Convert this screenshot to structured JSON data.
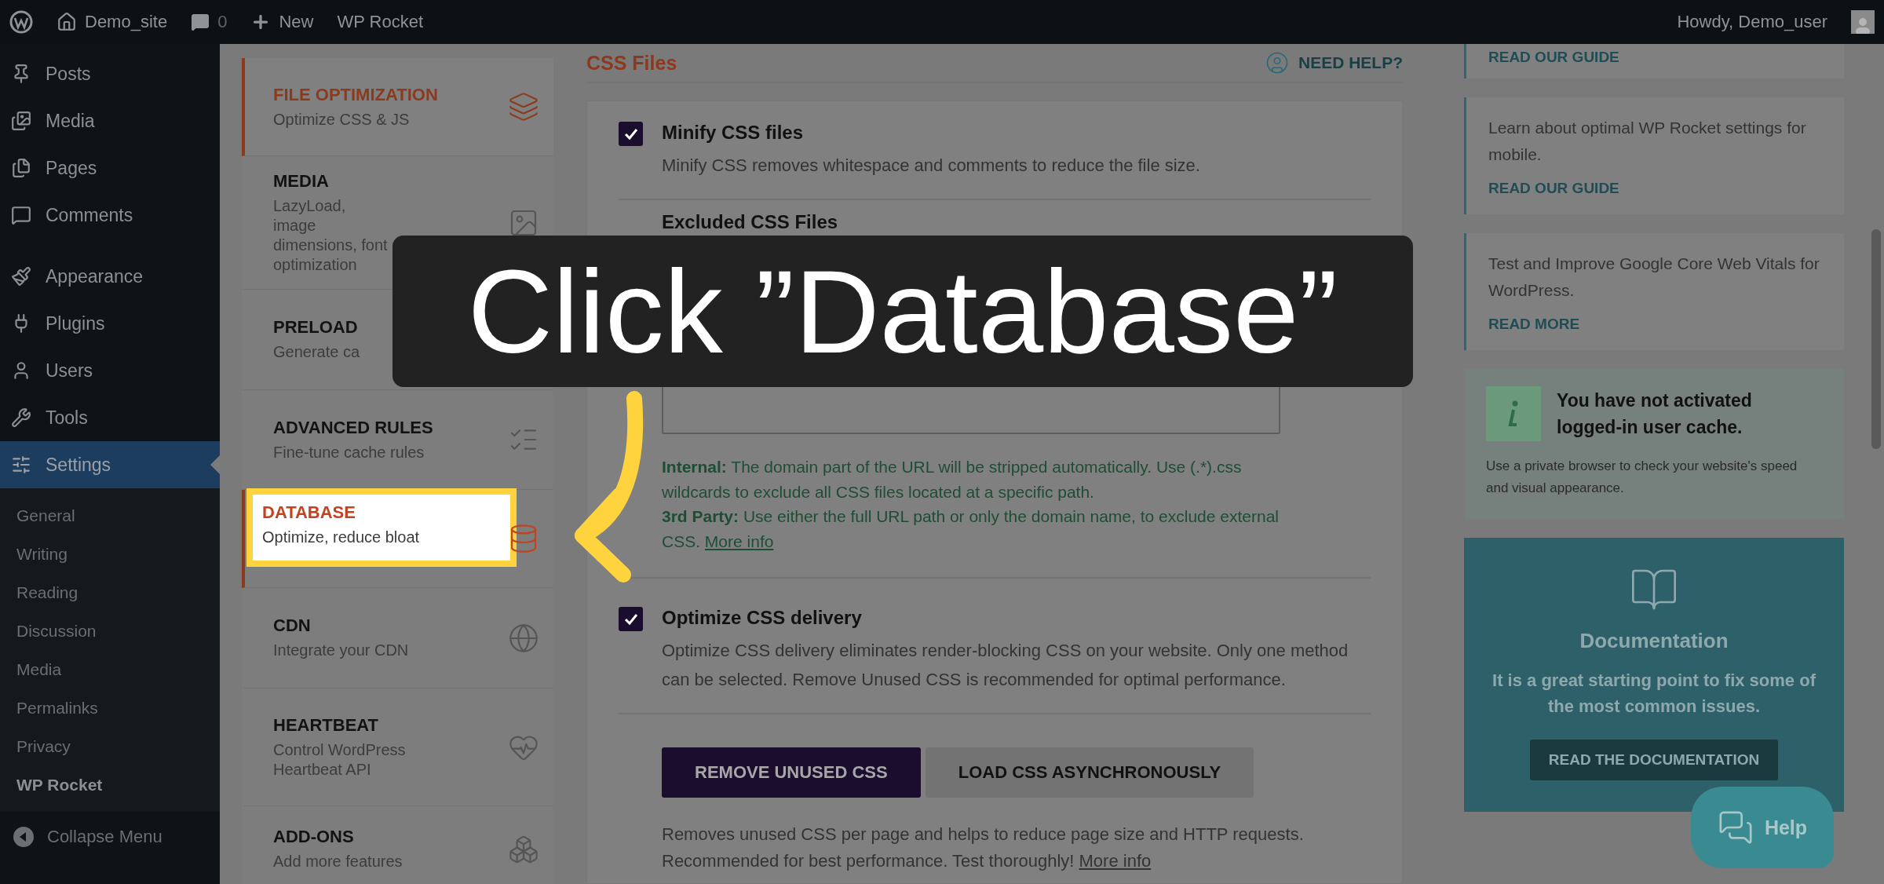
{
  "admin_bar": {
    "site": "Demo_site",
    "comments": "0",
    "new": "New",
    "plugin": "WP Rocket",
    "greeting": "Howdy, Demo_user"
  },
  "admin_menu": {
    "groups": [
      [
        {
          "label": "Posts",
          "selected": false
        },
        {
          "label": "Media",
          "selected": false
        },
        {
          "label": "Pages",
          "selected": false
        },
        {
          "label": "Comments",
          "selected": false
        }
      ],
      [
        {
          "label": "Appearance",
          "selected": false
        },
        {
          "label": "Plugins",
          "selected": false
        },
        {
          "label": "Users",
          "selected": false
        },
        {
          "label": "Tools",
          "selected": false
        },
        {
          "label": "Settings",
          "selected": true
        }
      ]
    ],
    "submenu": [
      {
        "label": "General",
        "selected": false
      },
      {
        "label": "Writing",
        "selected": false
      },
      {
        "label": "Reading",
        "selected": false
      },
      {
        "label": "Discussion",
        "selected": false
      },
      {
        "label": "Media",
        "selected": false
      },
      {
        "label": "Permalinks",
        "selected": false
      },
      {
        "label": "Privacy",
        "selected": false
      },
      {
        "label": "WP Rocket",
        "selected": true
      }
    ],
    "collapse": "Collapse Menu"
  },
  "plugin_nav": [
    {
      "title": "FILE OPTIMIZATION",
      "subtitle": "Optimize CSS & JS",
      "selected": true,
      "highlighted": false
    },
    {
      "title": "MEDIA",
      "subtitle": "LazyLoad, image dimensions, font optimization",
      "selected": false,
      "highlighted": false
    },
    {
      "title": "PRELOAD",
      "subtitle": "Generate ca",
      "selected": false,
      "highlighted": false
    },
    {
      "title": "ADVANCED RULES",
      "subtitle": "Fine-tune cache rules",
      "selected": false,
      "highlighted": false
    },
    {
      "title": "DATABASE",
      "subtitle": "Optimize, reduce bloat",
      "selected": false,
      "highlighted": true
    },
    {
      "title": "CDN",
      "subtitle": "Integrate your CDN",
      "selected": false,
      "highlighted": false
    },
    {
      "title": "HEARTBEAT",
      "subtitle": "Control WordPress Heartbeat API",
      "selected": false,
      "highlighted": false
    },
    {
      "title": "ADD-ONS",
      "subtitle": "Add more features",
      "selected": false,
      "highlighted": false
    }
  ],
  "main": {
    "section_title": "CSS Files",
    "need_help": "NEED HELP?",
    "minify": {
      "label": "Minify CSS files",
      "description": "Minify CSS removes whitespace and comments to reduce the file size.",
      "checked": true
    },
    "excluded": {
      "label": "Excluded CSS Files",
      "notes": [
        "**Internal:** The domain part of the URL will be stripped automatically. Use (.*).css wildcards to exclude all CSS files located at a specific path.",
        "**3rd Party:** Use either the full URL path or only the domain name, to exclude external CSS."
      ],
      "note_link": "More info"
    },
    "delivery": {
      "label": "Optimize CSS delivery",
      "description": "Optimize CSS delivery eliminates render-blocking CSS on your website. Only one method can be selected. Remove Unused CSS is recommended for optimal performance.",
      "checked": true
    },
    "methods": [
      {
        "label": "REMOVE UNUSED CSS",
        "selected": true
      },
      {
        "label": "LOAD CSS ASYNCHRONOUSLY",
        "selected": false
      }
    ],
    "method_description": "Removes unused CSS per page and helps to reduce page size and HTTP requests. Recommended for best performance. Test thoroughly!",
    "method_link": "More info"
  },
  "sidebar": {
    "guides": [
      {
        "link": "READ OUR GUIDE"
      },
      {
        "text": "Learn about optimal WP Rocket settings for mobile.",
        "link": "READ OUR GUIDE"
      },
      {
        "text": "Test and Improve Google Core Web Vitals for WordPress.",
        "link": "READ MORE"
      }
    ],
    "notice": {
      "title": "You have not activated logged-in user cache.",
      "text": "Use a private browser to check your website's speed and visual appearance."
    },
    "documentation": {
      "title": "Documentation",
      "text": "It is a great starting point to fix some of the most common issues.",
      "button": "READ THE DOCUMENTATION"
    }
  },
  "help_button": "Help",
  "callout": {
    "text": "Click ”Database”"
  }
}
